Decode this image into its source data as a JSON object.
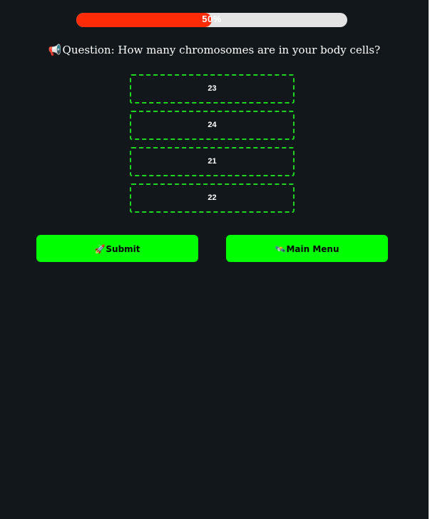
{
  "progress": {
    "percent": 50,
    "label": "50%",
    "fill_color": "#ff2a06",
    "track_color": "#e3e3e3"
  },
  "question": {
    "icon": "megaphone-icon",
    "icon_glyph": "📢",
    "text": "Question: How many chromosomes are in your body cells?"
  },
  "options": [
    {
      "label": "23"
    },
    {
      "label": "24"
    },
    {
      "label": "21"
    },
    {
      "label": "22"
    }
  ],
  "buttons": {
    "submit": {
      "icon": "rocket-icon",
      "icon_glyph": "🚀",
      "label": "Submit"
    },
    "main_menu": {
      "icon": "satellite-icon",
      "icon_glyph": "🛰️",
      "label": "Main Menu"
    }
  },
  "colors": {
    "background": "#11171b",
    "accent_green": "#00ff00",
    "option_border": "#1ed620"
  }
}
